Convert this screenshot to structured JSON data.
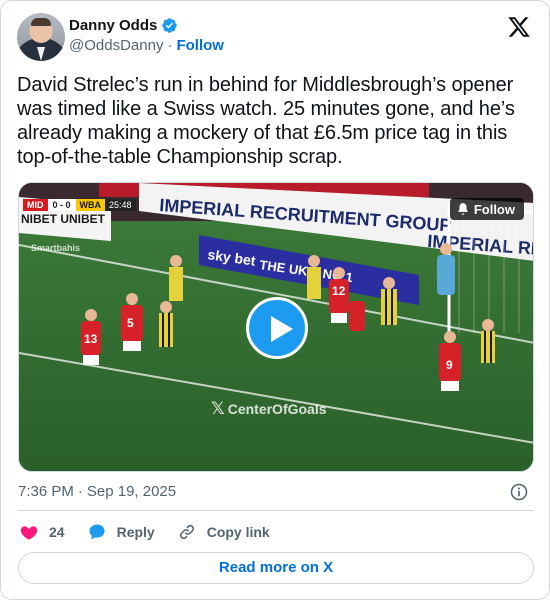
{
  "author": {
    "name": "Danny Odds",
    "handle": "@OddsDanny",
    "separator": "·",
    "follow_label": "Follow"
  },
  "tweet": {
    "text": "David Strelec’s run in behind for Middlesbrough’s opener was timed like a Swiss watch. 25 minutes gone, and he’s already making a mockery of that £6.5m price tag in this top-of-the-table Championship scrap."
  },
  "media": {
    "scoreboard": {
      "team1": "MID",
      "score": "0 - 0",
      "team2": "WBA",
      "clock": "25:48"
    },
    "follow_overlay_label": "Follow",
    "watermark": "CenterOfGoals",
    "hoardings": [
      "IMPERIAL RECRUITMENT GROUP",
      "IMPERIAL RE",
      "NIBET UNIBET",
      "sky bet",
      "THE UK'S NO.1"
    ],
    "sponsor_small": "Smartbahis",
    "shirt_numbers": [
      "13",
      "5",
      "9",
      "12"
    ],
    "icons": [
      "play-icon",
      "bell-icon",
      "x-logo-icon"
    ]
  },
  "meta": {
    "time": "7:36 PM",
    "separator": "·",
    "date": "Sep 19, 2025"
  },
  "actions": {
    "likes": "24",
    "reply_label": "Reply",
    "copy_label": "Copy link"
  },
  "footer": {
    "read_more_label": "Read more on X"
  },
  "colors": {
    "accent": "#1d9bf0",
    "link": "#006fd6",
    "like": "#f91880",
    "text": "#0f1419",
    "muted": "#536471",
    "border": "#cfd9de"
  }
}
